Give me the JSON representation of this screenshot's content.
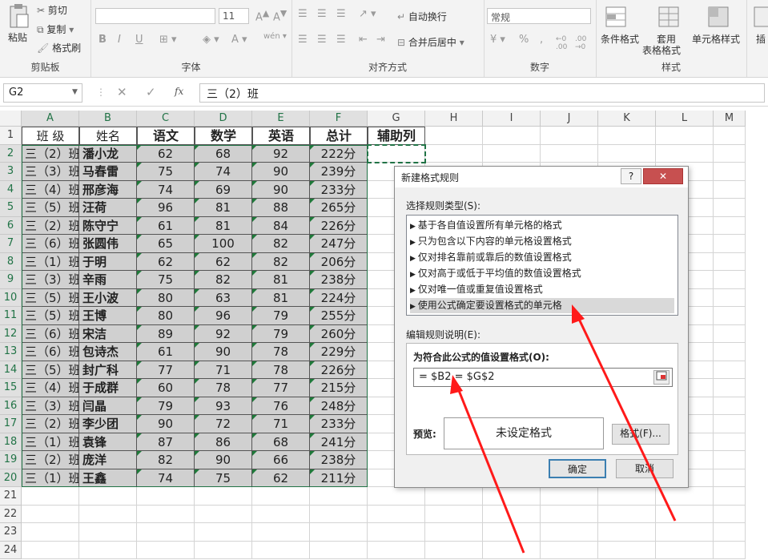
{
  "ribbon": {
    "clipboard": {
      "paste": "粘贴",
      "cut": "剪切",
      "copy": "复制",
      "format_painter": "格式刷",
      "label": "剪贴板"
    },
    "font": {
      "name_value": "",
      "size_value": "11",
      "bold": "B",
      "italic": "I",
      "underline": "U",
      "label": "字体"
    },
    "alignment": {
      "wrap_text": "自动换行",
      "merge_center": "合并后居中",
      "label": "对齐方式"
    },
    "number": {
      "format_value": "常规",
      "percent": "%",
      "comma": ",",
      "label": "数字"
    },
    "styles": {
      "conditional": "条件格式",
      "table_format_1": "套用",
      "table_format_2": "表格格式",
      "cell_styles": "单元格样式",
      "label": "样式"
    },
    "cells": {
      "insert": "插"
    }
  },
  "formula_bar": {
    "name_box": "G2",
    "fx": "fx",
    "content": "三（2）班"
  },
  "sheet": {
    "columns": [
      "A",
      "B",
      "C",
      "D",
      "E",
      "F",
      "G",
      "H",
      "I",
      "J",
      "K",
      "L",
      "M"
    ],
    "rows": [
      "1",
      "2",
      "3",
      "4",
      "5",
      "6",
      "7",
      "8",
      "9",
      "10",
      "11",
      "12",
      "13",
      "14",
      "15",
      "16",
      "17",
      "18",
      "19",
      "20",
      "21",
      "22",
      "23",
      "24"
    ],
    "headers": [
      "班 级",
      "姓名",
      "语文",
      "数学",
      "英语",
      "总计",
      "辅助列"
    ],
    "data": [
      [
        "三（2）班",
        "潘小龙",
        "62",
        "68",
        "92",
        "222分"
      ],
      [
        "三（3）班",
        "马春雷",
        "75",
        "74",
        "90",
        "239分"
      ],
      [
        "三（4）班",
        "邢彦海",
        "74",
        "69",
        "90",
        "233分"
      ],
      [
        "三（5）班",
        "汪荷",
        "96",
        "81",
        "88",
        "265分"
      ],
      [
        "三（2）班",
        "陈守宁",
        "61",
        "81",
        "84",
        "226分"
      ],
      [
        "三（6）班",
        "张圆伟",
        "65",
        "100",
        "82",
        "247分"
      ],
      [
        "三（1）班",
        "于明",
        "62",
        "62",
        "82",
        "206分"
      ],
      [
        "三（3）班",
        "辛雨",
        "75",
        "82",
        "81",
        "238分"
      ],
      [
        "三（5）班",
        "王小波",
        "80",
        "63",
        "81",
        "224分"
      ],
      [
        "三（5）班",
        "王博",
        "80",
        "96",
        "79",
        "255分"
      ],
      [
        "三（6）班",
        "宋洁",
        "89",
        "92",
        "79",
        "260分"
      ],
      [
        "三（6）班",
        "包诗杰",
        "61",
        "90",
        "78",
        "229分"
      ],
      [
        "三（5）班",
        "封广科",
        "77",
        "71",
        "78",
        "226分"
      ],
      [
        "三（4）班",
        "于成群",
        "60",
        "78",
        "77",
        "215分"
      ],
      [
        "三（3）班",
        "闫晶",
        "79",
        "93",
        "76",
        "248分"
      ],
      [
        "三（2）班",
        "李少团",
        "90",
        "72",
        "71",
        "233分"
      ],
      [
        "三（1）班",
        "袁锋",
        "87",
        "86",
        "68",
        "241分"
      ],
      [
        "三（2）班",
        "庞洋",
        "82",
        "90",
        "66",
        "238分"
      ],
      [
        "三（1）班",
        "王鑫",
        "74",
        "75",
        "62",
        "211分"
      ]
    ]
  },
  "dialog": {
    "title": "新建格式规则",
    "help": "?",
    "close": "✕",
    "select_type_label": "选择规则类型(S):",
    "rules": [
      "基于各自值设置所有单元格的格式",
      "只为包含以下内容的单元格设置格式",
      "仅对排名靠前或靠后的数值设置格式",
      "仅对高于或低于平均值的数值设置格式",
      "仅对唯一值或重复值设置格式",
      "使用公式确定要设置格式的单元格"
    ],
    "edit_label": "编辑规则说明(E):",
    "formula_label": "为符合此公式的值设置格式(O):",
    "formula_value": "= $B2 = $G$2",
    "preview_label": "预览:",
    "preview_text": "未设定格式",
    "format_button": "格式(F)...",
    "ok_button": "确定",
    "cancel_button": "取消"
  },
  "colors": {
    "accent": "#217346",
    "arrow": "#ff1a1a",
    "data_fill": "#d0d0d0",
    "selected_rule": "#d9d9d9"
  }
}
